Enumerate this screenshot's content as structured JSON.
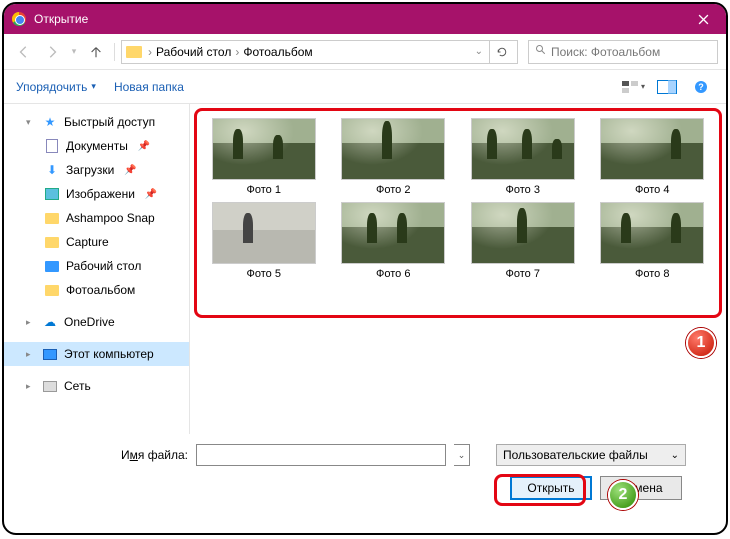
{
  "titlebar": {
    "title": "Открытие"
  },
  "nav": {
    "crumb1": "Рабочий стол",
    "crumb2": "Фотоальбом",
    "search_placeholder": "Поиск: Фотоальбом"
  },
  "toolbar": {
    "organize": "Упорядочить",
    "newfolder": "Новая папка"
  },
  "sidebar": {
    "quick": "Быстрый доступ",
    "docs": "Документы",
    "downloads": "Загрузки",
    "pictures": "Изображени",
    "ashampoo": "Ashampoo Snap",
    "capture": "Capture",
    "desktop": "Рабочий стол",
    "photoalbum": "Фотоальбом",
    "onedrive": "OneDrive",
    "thispc": "Этот компьютер",
    "network": "Сеть"
  },
  "files": {
    "items": [
      {
        "label": "Фото 1"
      },
      {
        "label": "Фото 2"
      },
      {
        "label": "Фото 3"
      },
      {
        "label": "Фото 4"
      },
      {
        "label": "Фото 5"
      },
      {
        "label": "Фото 6"
      },
      {
        "label": "Фото 7"
      },
      {
        "label": "Фото 8"
      }
    ]
  },
  "footer": {
    "filename_label_pre": "И",
    "filename_label_u": "м",
    "filename_label_post": "я файла:",
    "filetype": "Пользовательские файлы",
    "open": "Открыть",
    "cancel": "Отмена"
  },
  "callouts": {
    "one": "1",
    "two": "2"
  }
}
